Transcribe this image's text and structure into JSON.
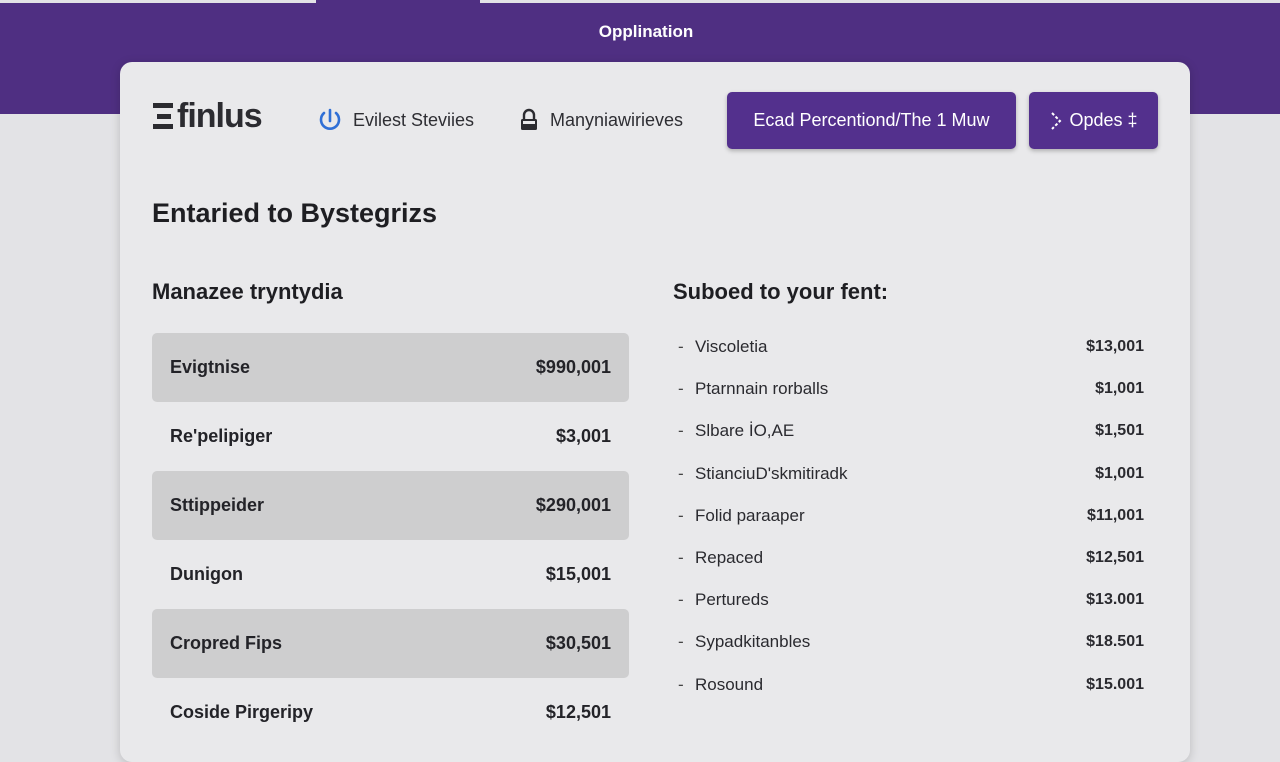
{
  "app": {
    "title": "Opplination"
  },
  "header": {
    "logo_text": "finlus",
    "nav": [
      {
        "label": "Evilest Steviies",
        "icon": "refresh-icon"
      },
      {
        "label": "Manyniawirieves",
        "icon": "lock-icon"
      }
    ],
    "primary_button": "Ecad Percentiond/The 1 Muw",
    "options_button": "Opdes ‡",
    "options_icon": "chevron-right-icon"
  },
  "page": {
    "heading": "Entaried to Bystegrizs"
  },
  "left_section": {
    "title": "Manazee tryntydia",
    "rows": [
      {
        "label": "Evigtnise",
        "amount": "$990,001",
        "shaded": true
      },
      {
        "label": "Re'pelipiger",
        "amount": "$3,001",
        "shaded": false
      },
      {
        "label": "Sttippeider",
        "amount": "$290,001",
        "shaded": true
      },
      {
        "label": "Dunigon",
        "amount": "$15,001",
        "shaded": false
      },
      {
        "label": "Cropred Fips",
        "amount": "$30,501",
        "shaded": true
      },
      {
        "label": "Coside Pirgeripy",
        "amount": "$12,501",
        "shaded": false
      }
    ]
  },
  "right_section": {
    "title": "Suboed to your fent:",
    "rows": [
      {
        "label": "Viscoletia",
        "amount": "$13,001"
      },
      {
        "label": "Ptarnnain rorballs",
        "amount": "$1,001"
      },
      {
        "label": "Slbare İO,AE",
        "amount": "$1,501"
      },
      {
        "label": "StianciuD'skmitiradk",
        "amount": "$1,001"
      },
      {
        "label": "Folid paraaper",
        "amount": "$11,001"
      },
      {
        "label": "Repaced",
        "amount": "$12,501"
      },
      {
        "label": "Pertureds",
        "amount": "$13.001"
      },
      {
        "label": "Sypadkitanbles",
        "amount": "$18.501"
      },
      {
        "label": "Rosound",
        "amount": "$15.001"
      }
    ]
  },
  "colors": {
    "brand": "#4f2f82",
    "button": "#53308d",
    "row_shade": "#cececf",
    "background": "#e3e3e6"
  }
}
